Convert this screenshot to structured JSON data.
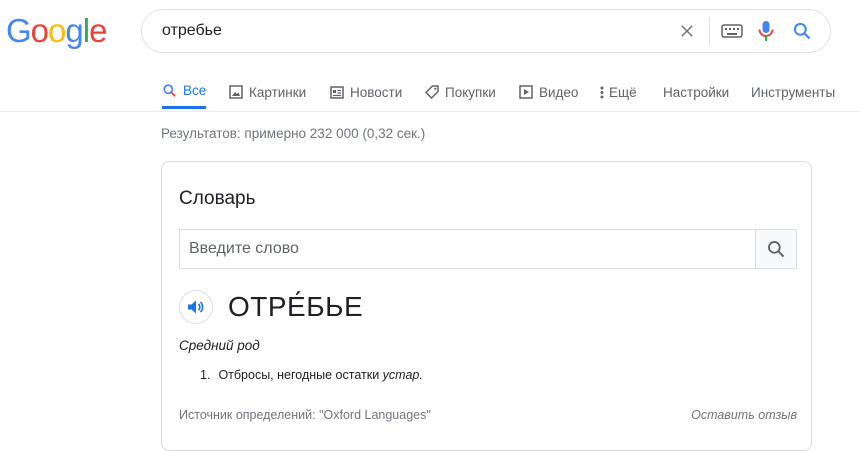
{
  "logo": {
    "text": "Google",
    "colors": [
      "#4285F4",
      "#EA4335",
      "#FBBC05",
      "#4285F4",
      "#34A853",
      "#EA4335"
    ]
  },
  "search": {
    "query": "отребье"
  },
  "tabs": [
    {
      "label": "Все",
      "icon": "search-icon",
      "active": true
    },
    {
      "label": "Картинки",
      "icon": "image-icon"
    },
    {
      "label": "Новости",
      "icon": "news-icon"
    },
    {
      "label": "Покупки",
      "icon": "tag-icon"
    },
    {
      "label": "Видео",
      "icon": "video-icon"
    },
    {
      "label": "Ещё",
      "icon": "more-vert-icon"
    },
    {
      "label": "Настройки"
    },
    {
      "label": "Инструменты"
    }
  ],
  "results_stats": "Результатов: примерно 232 000 (0,32 сек.)",
  "dictionary": {
    "title": "Словарь",
    "input_placeholder": "Введите слово",
    "word": "ОТРЕ́БЬЕ",
    "part_of_speech": "Средний род",
    "definitions": [
      {
        "number": "1.",
        "text": "Отбросы, негодные остатки ",
        "label": "устар."
      }
    ],
    "source": "Источник определений: \"Oxford Languages\"",
    "feedback": "Оставить отзыв"
  },
  "colors": {
    "accent": "#1a73e8",
    "mic_blue": "#4285F4",
    "mic_red": "#EA4335"
  }
}
